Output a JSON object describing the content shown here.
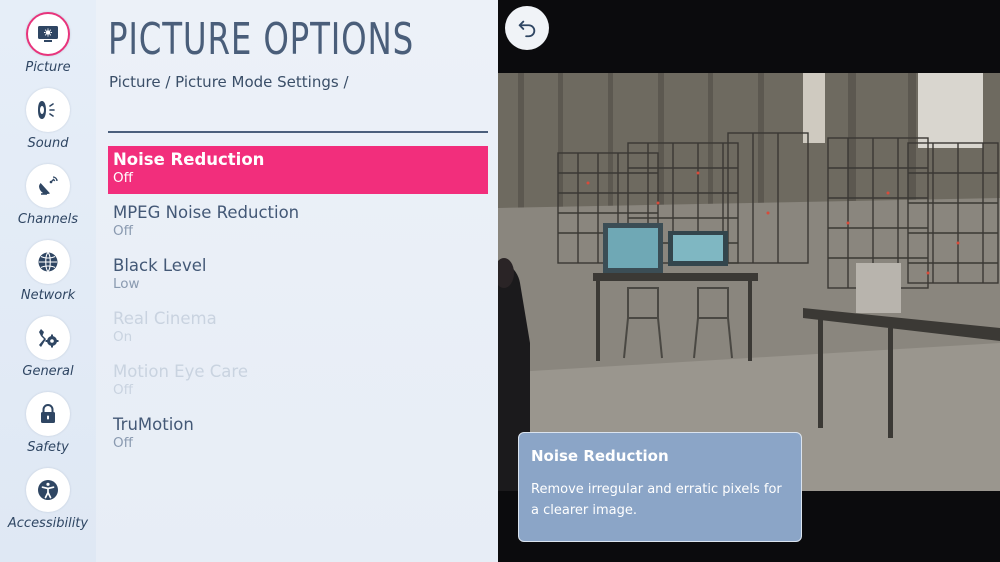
{
  "nav": {
    "items": [
      {
        "label": "Picture",
        "icon": "picture-icon",
        "active": true
      },
      {
        "label": "Sound",
        "icon": "sound-icon",
        "active": false
      },
      {
        "label": "Channels",
        "icon": "channels-icon",
        "active": false
      },
      {
        "label": "Network",
        "icon": "network-icon",
        "active": false
      },
      {
        "label": "General",
        "icon": "general-icon",
        "active": false
      },
      {
        "label": "Safety",
        "icon": "lock-icon",
        "active": false
      },
      {
        "label": "Accessibility",
        "icon": "accessibility-icon",
        "active": false
      }
    ]
  },
  "panel": {
    "title": "PICTURE OPTIONS",
    "breadcrumb": "Picture / Picture Mode Settings /",
    "items": [
      {
        "label": "Noise Reduction",
        "value": "Off",
        "state": "selected"
      },
      {
        "label": "MPEG Noise Reduction",
        "value": "Off",
        "state": "normal"
      },
      {
        "label": "Black Level",
        "value": "Low",
        "state": "normal"
      },
      {
        "label": "Real Cinema",
        "value": "On",
        "state": "disabled"
      },
      {
        "label": "Motion Eye Care",
        "value": "Off",
        "state": "disabled"
      },
      {
        "label": "TruMotion",
        "value": "Off",
        "state": "normal"
      }
    ]
  },
  "preview": {
    "back_icon": "back-arrow-icon",
    "tooltip": {
      "title": "Noise Reduction",
      "body": "Remove irregular and erratic pixels for a clearer image."
    }
  },
  "colors": {
    "accent": "#f22e7c",
    "panel_bg": "#ecf1f8",
    "nav_text": "#2f4663",
    "tooltip_bg": "#8ba5c7"
  }
}
